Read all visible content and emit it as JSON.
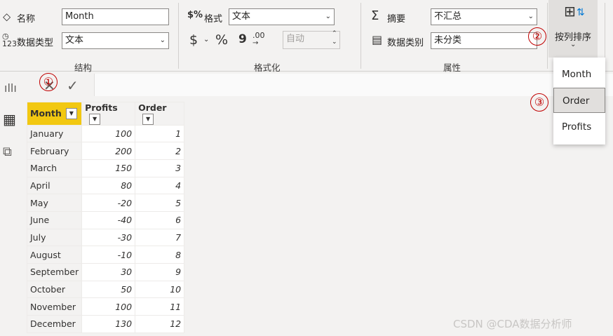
{
  "ribbon": {
    "structure": {
      "name_label": "名称",
      "name_value": "Month",
      "datatype_label": "数据类型",
      "datatype_value": "文本",
      "group_label": "结构"
    },
    "formatting": {
      "format_label": "格式",
      "format_value": "文本",
      "currency_symbol": "$",
      "percent_symbol": "%",
      "comma_symbol": "9",
      "decimal_symbol": ".00",
      "auto_value": "自动",
      "group_label": "格式化"
    },
    "properties": {
      "summarize_label": "摘要",
      "summarize_value": "不汇总",
      "category_label": "数据类别",
      "category_value": "未分类",
      "group_label": "属性"
    },
    "sort_by_column": {
      "label": "按列排序"
    }
  },
  "sort_menu": {
    "items": [
      "Month",
      "Order",
      "Profits"
    ],
    "active_index": 1
  },
  "annotations": {
    "one": "①",
    "two": "②",
    "three": "③"
  },
  "table": {
    "columns": [
      "Month",
      "Profits",
      "Order"
    ],
    "rows": [
      [
        "January",
        "100",
        "1"
      ],
      [
        "February",
        "200",
        "2"
      ],
      [
        "March",
        "150",
        "3"
      ],
      [
        "April",
        "80",
        "4"
      ],
      [
        "May",
        "-20",
        "5"
      ],
      [
        "June",
        "-40",
        "6"
      ],
      [
        "July",
        "-30",
        "7"
      ],
      [
        "August",
        "-10",
        "8"
      ],
      [
        "September",
        "30",
        "9"
      ],
      [
        "October",
        "50",
        "10"
      ],
      [
        "November",
        "100",
        "11"
      ],
      [
        "December",
        "130",
        "12"
      ]
    ]
  },
  "watermark": "CSDN @CDA数据分析师",
  "colors": {
    "selected_header": "#f2c811",
    "annotation_red": "#c00000"
  }
}
